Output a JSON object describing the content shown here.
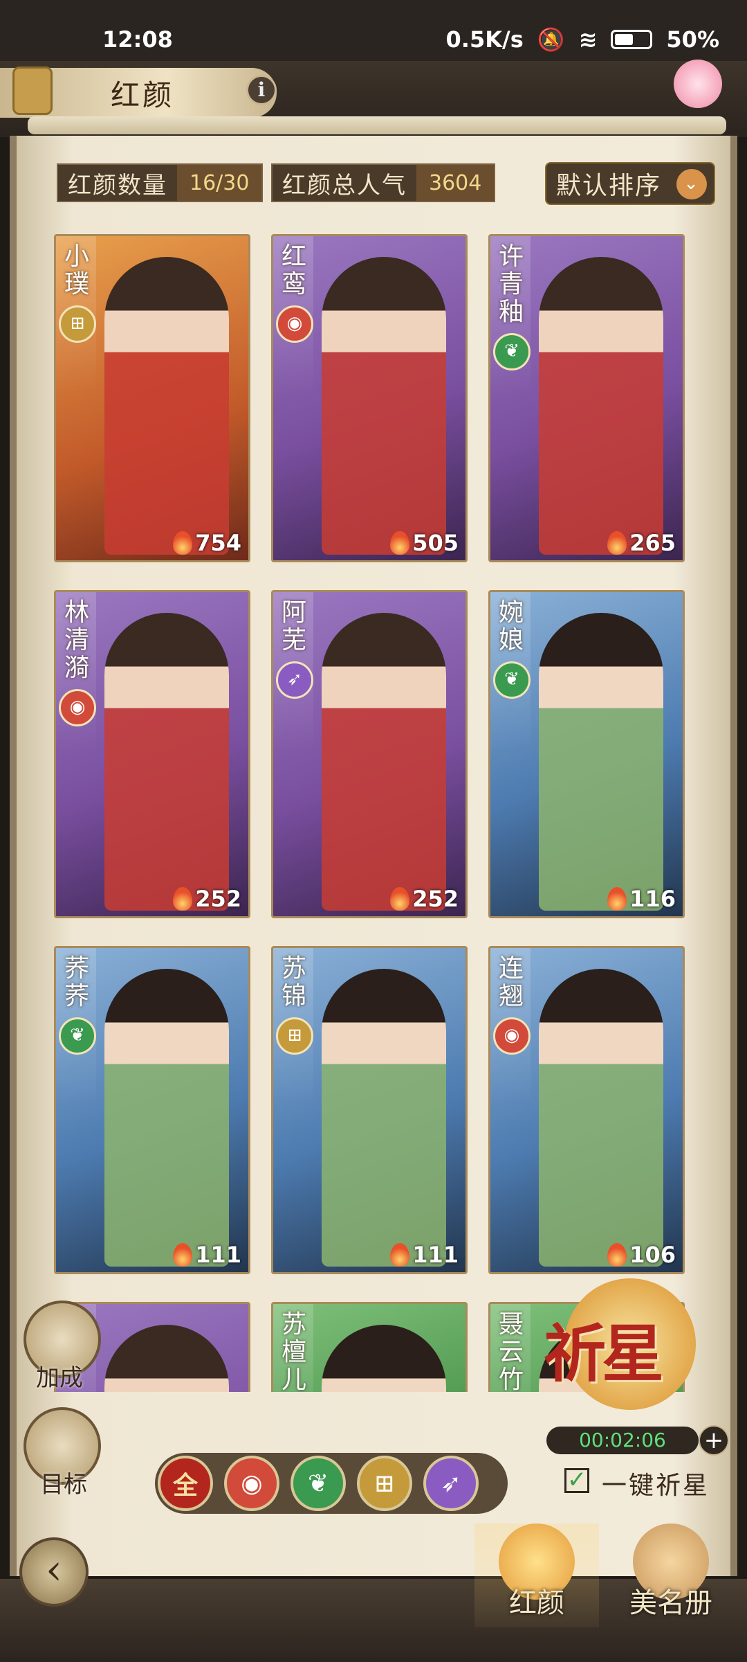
{
  "status_bar": {
    "time": "12:08",
    "network": "0.5K/s",
    "battery": "50%"
  },
  "header": {
    "title": "红颜",
    "info": "i"
  },
  "stats": {
    "count_label": "红颜数量",
    "count_value": "16/30",
    "popularity_label": "红颜总人气",
    "popularity_value": "3604",
    "sort_label": "默认排序"
  },
  "cards": [
    {
      "name": "小璞",
      "type": "gold",
      "popularity": "754",
      "theme": "orange"
    },
    {
      "name": "红鸾",
      "type": "red",
      "popularity": "505",
      "theme": "purple"
    },
    {
      "name": "许青釉",
      "type": "green",
      "popularity": "265",
      "theme": "purple"
    },
    {
      "name": "林清漪",
      "type": "red",
      "popularity": "252",
      "theme": "purple"
    },
    {
      "name": "阿芜",
      "type": "purple",
      "popularity": "252",
      "theme": "purple"
    },
    {
      "name": "婉娘",
      "type": "green",
      "popularity": "116",
      "theme": "blue"
    },
    {
      "name": "荞荞",
      "type": "green",
      "popularity": "111",
      "theme": "blue"
    },
    {
      "name": "苏锦",
      "type": "gold",
      "popularity": "111",
      "theme": "blue"
    },
    {
      "name": "连翘",
      "type": "red",
      "popularity": "106",
      "theme": "blue"
    },
    {
      "name": "",
      "type": "purple",
      "popularity": "",
      "theme": "purple"
    },
    {
      "name": "苏檀儿",
      "type": "green",
      "popularity": "",
      "theme": "green"
    },
    {
      "name": "聂云竹",
      "type": "green",
      "popularity": "",
      "theme": "green"
    }
  ],
  "side": {
    "bonus_label": "加成",
    "target_label": "目标"
  },
  "pray": {
    "label": "祈星",
    "timer": "00:02:06",
    "plus": "+",
    "auto_label": "一键祈星",
    "auto_checked": true
  },
  "filters": [
    {
      "label": "全",
      "kind": "all"
    },
    {
      "label": "",
      "kind": "red"
    },
    {
      "label": "",
      "kind": "green"
    },
    {
      "label": "",
      "kind": "gold"
    },
    {
      "label": "",
      "kind": "purple"
    }
  ],
  "nav": {
    "tab_hongyan": "红颜",
    "tab_meimingce": "美名册",
    "back": "‹"
  },
  "colors": {
    "gold": "#c49a3a",
    "red": "#d24a3a",
    "green": "#3a9a50",
    "purple": "#8a5cc2"
  }
}
